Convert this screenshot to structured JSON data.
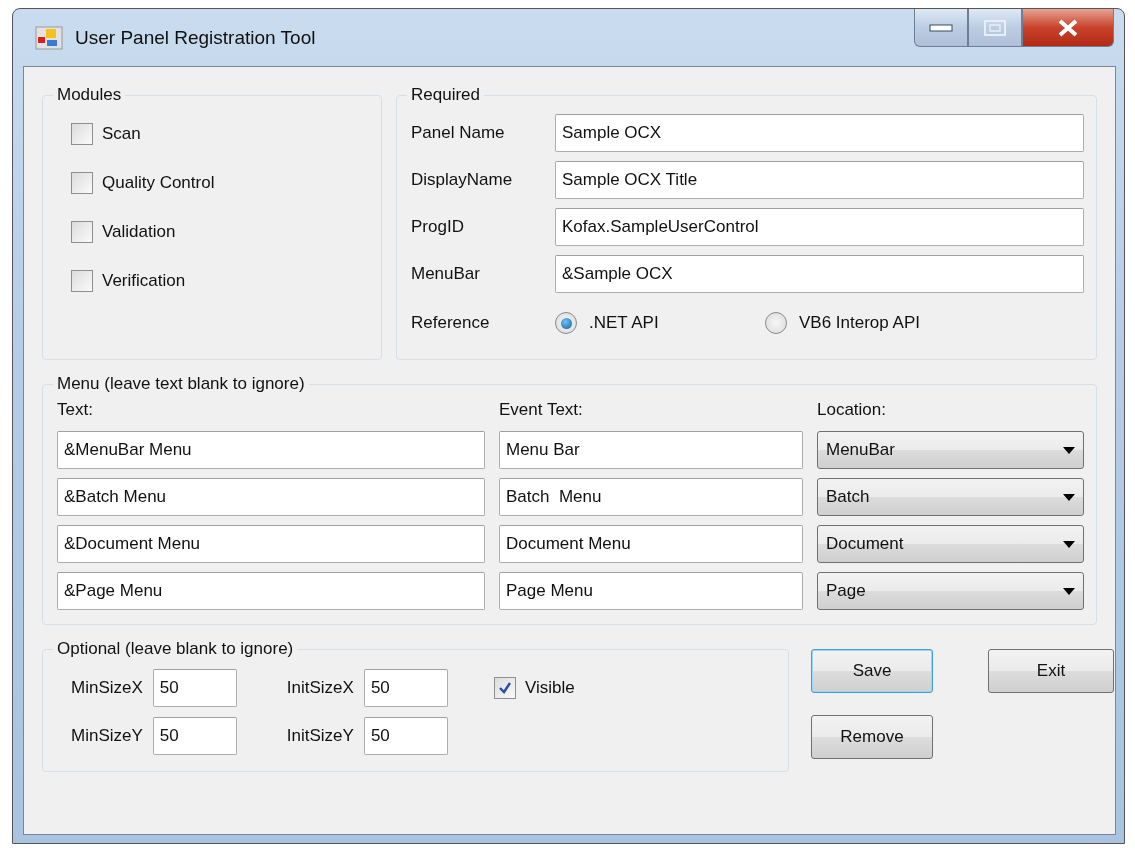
{
  "window": {
    "title": "User Panel Registration Tool"
  },
  "modules": {
    "title": "Modules",
    "items": [
      {
        "label": "Scan",
        "checked": false
      },
      {
        "label": "Quality Control",
        "checked": false
      },
      {
        "label": "Validation",
        "checked": false
      },
      {
        "label": "Verification",
        "checked": false
      }
    ]
  },
  "required": {
    "title": "Required",
    "fields": [
      {
        "label": "Panel Name",
        "value": "Sample OCX"
      },
      {
        "label": "DisplayName",
        "value": "Sample OCX Title"
      },
      {
        "label": "ProgID",
        "value": "Kofax.SampleUserControl"
      },
      {
        "label": "MenuBar",
        "value": "&Sample OCX"
      }
    ],
    "reference": {
      "label": "Reference",
      "options": [
        {
          "label": ".NET API",
          "selected": true
        },
        {
          "label": "VB6 Interop API",
          "selected": false
        }
      ]
    }
  },
  "menu": {
    "title": "Menu (leave text blank to ignore)",
    "columns": [
      "Text:",
      "Event Text:",
      "Location:"
    ],
    "rows": [
      {
        "text": "&MenuBar Menu",
        "event_text": "Menu Bar",
        "location": "MenuBar"
      },
      {
        "text": "&Batch Menu",
        "event_text": "Batch  Menu",
        "location": "Batch"
      },
      {
        "text": "&Document Menu",
        "event_text": "Document Menu",
        "location": "Document"
      },
      {
        "text": "&Page Menu",
        "event_text": "Page Menu",
        "location": "Page"
      }
    ]
  },
  "optional": {
    "title": "Optional (leave blank to ignore)",
    "fields": [
      {
        "label": "MinSizeX",
        "value": "50"
      },
      {
        "label": "InitSizeX",
        "value": "50"
      },
      {
        "label": "MinSizeY",
        "value": "50"
      },
      {
        "label": "InitSizeY",
        "value": "50"
      }
    ],
    "visible": {
      "label": "Visible",
      "checked": true
    }
  },
  "buttons": [
    {
      "label": "Save",
      "default": true
    },
    {
      "label": "Exit",
      "default": false
    },
    {
      "label": "Remove",
      "default": false
    }
  ]
}
